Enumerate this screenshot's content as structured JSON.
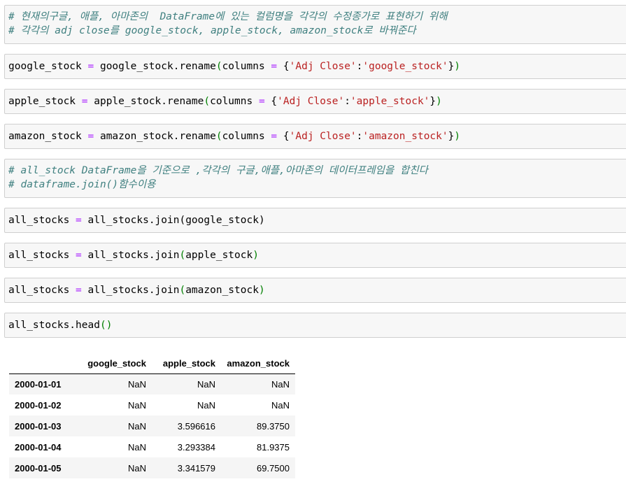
{
  "cells": [
    {
      "lines": [
        "# 현재의구글, 애플, 아마존의  DataFrame에 있는 컬럼명을 각각의 수정종가로 표현하기 위해",
        "# 각각의 adj close를 google_stock, apple_stock, amazon_stock로 바꿔준다"
      ]
    },
    {
      "var": "google_stock",
      "eq": "=",
      "call": "google_stock.rename",
      "lp": "(",
      "arg": "columns",
      "lb": "{",
      "key": "'Adj Close'",
      "colon": ":",
      "val": "'google_stock'",
      "rb": "}",
      "rp": ")"
    },
    {
      "var": "apple_stock",
      "eq": "=",
      "call": "apple_stock.rename",
      "lp": "(",
      "arg": "columns",
      "lb": "{",
      "key": "'Adj Close'",
      "colon": ":",
      "val": "'apple_stock'",
      "rb": "}",
      "rp": ")"
    },
    {
      "var": "amazon_stock",
      "eq": "=",
      "call": "amazon_stock.rename",
      "lp": "(",
      "arg": "columns",
      "lb": "{",
      "key": "'Adj Close'",
      "colon": ":",
      "val": "'amazon_stock'",
      "rb": "}",
      "rp": ")"
    },
    {
      "lines": [
        "# all_stock DataFrame을 기준으로 ,각각의 구글,애플,아마존의 데이터프레임을 합친다",
        "# dataframe.join()함수이용"
      ]
    },
    {
      "var": "all_stocks",
      "eq": "=",
      "call": "all_stocks.join",
      "lp": "(",
      "arg": "google_stock",
      "rp": ")"
    },
    {
      "var": "all_stocks",
      "eq": "=",
      "call": "all_stocks.join",
      "lp": "(",
      "arg": "apple_stock",
      "rp": ")"
    },
    {
      "var": "all_stocks",
      "eq": "=",
      "call": "all_stocks.join",
      "lp": "(",
      "arg": "amazon_stock",
      "rp": ")"
    },
    {
      "call": "all_stocks.head",
      "lp": "(",
      "rp": ")"
    }
  ],
  "output_table": {
    "columns": [
      "google_stock",
      "apple_stock",
      "amazon_stock"
    ],
    "rows": [
      {
        "index": "2000-01-01",
        "values": [
          "NaN",
          "NaN",
          "NaN"
        ]
      },
      {
        "index": "2000-01-02",
        "values": [
          "NaN",
          "NaN",
          "NaN"
        ]
      },
      {
        "index": "2000-01-03",
        "values": [
          "NaN",
          "3.596616",
          "89.3750"
        ]
      },
      {
        "index": "2000-01-04",
        "values": [
          "NaN",
          "3.293384",
          "81.9375"
        ]
      },
      {
        "index": "2000-01-05",
        "values": [
          "NaN",
          "3.341579",
          "69.7500"
        ]
      }
    ]
  }
}
